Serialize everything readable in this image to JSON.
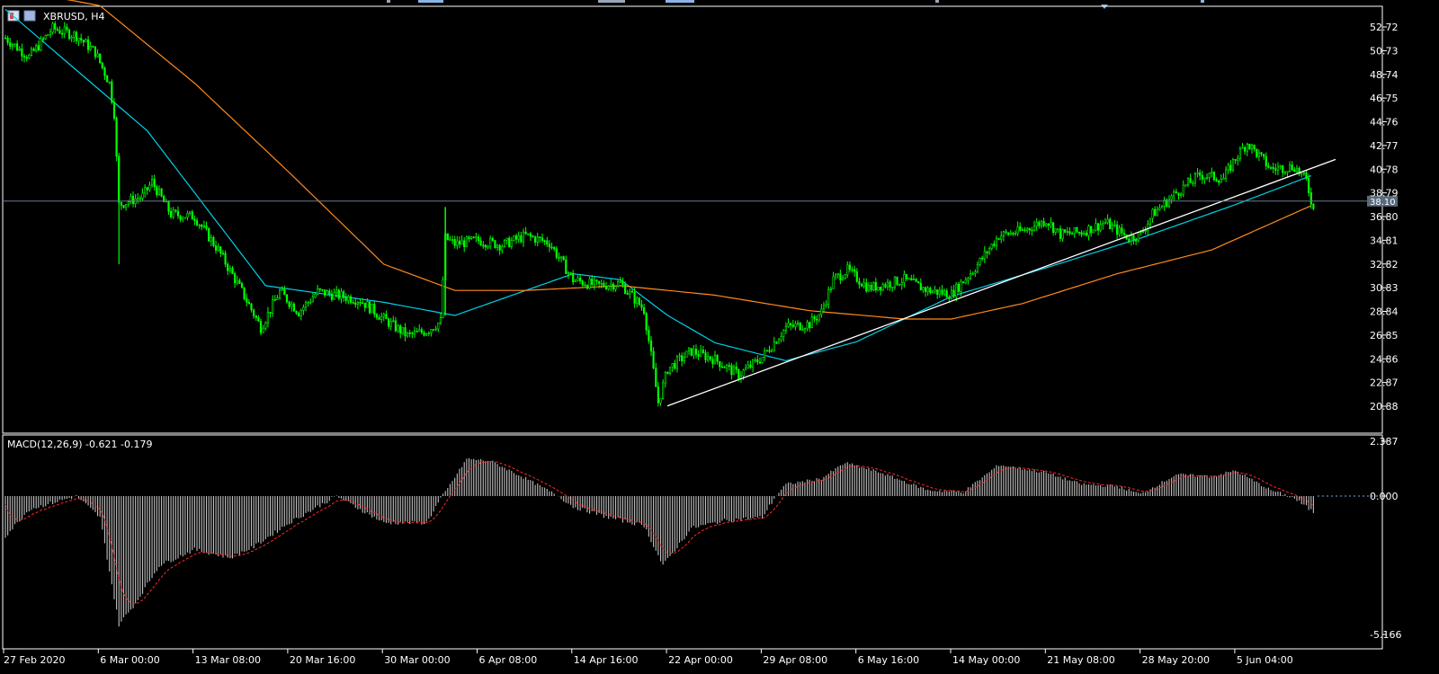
{
  "window": {
    "symbol_label": "XBRUSD, H4",
    "icon_name": "chart-window-icon"
  },
  "colors": {
    "background": "#000000",
    "bull_candle": "#00ff00",
    "bear_candle": "#00ff00",
    "ma_fast": "#00cfe8",
    "ma_slow": "#ff8a1c",
    "trendline": "#ffffff",
    "bid_line": "#6b7a8c",
    "price_tag_bg": "#5a6a7c",
    "macd_hist": "#c0c0c0",
    "macd_signal": "#ff2a2a",
    "axis_text": "#ffffff",
    "grid_frame": "#ffffff"
  },
  "price_axis": {
    "ticks": [
      "52.72",
      "50.73",
      "48.74",
      "46.75",
      "44.76",
      "42.77",
      "40.78",
      "38.79",
      "36.80",
      "34.81",
      "32.82",
      "30.83",
      "28.84",
      "26.85",
      "24.86",
      "22.87",
      "20.88"
    ],
    "current_price": "38.10"
  },
  "macd": {
    "label": "MACD(12,26,9) -0.621 -0.179",
    "ticks": [
      "2.387",
      "0.000",
      "-5.166"
    ]
  },
  "time_axis": {
    "ticks": [
      "27 Feb 2020",
      "6 Mar 00:00",
      "13 Mar 08:00",
      "20 Mar 16:00",
      "30 Mar 00:00",
      "6 Apr 08:00",
      "14 Apr 16:00",
      "22 Apr 00:00",
      "29 Apr 08:00",
      "6 May 16:00",
      "14 May 00:00",
      "21 May 08:00",
      "28 May 20:00",
      "5 Jun 04:00"
    ]
  },
  "chart_data": {
    "type": "candlestick",
    "symbol": "XBRUSD",
    "timeframe": "H4",
    "ylim": [
      19.9,
      53.7
    ],
    "current_price": 38.1,
    "anchors": [
      [
        0,
        51.8
      ],
      [
        10,
        50.2
      ],
      [
        20,
        52.6
      ],
      [
        30,
        52.0
      ],
      [
        38,
        50.6
      ],
      [
        44,
        48.0
      ],
      [
        46,
        45.5
      ],
      [
        48,
        37.8
      ],
      [
        58,
        38.5
      ],
      [
        62,
        39.7
      ],
      [
        70,
        37.0
      ],
      [
        80,
        36.8
      ],
      [
        90,
        34.0
      ],
      [
        100,
        30.5
      ],
      [
        108,
        27.5
      ],
      [
        116,
        30.5
      ],
      [
        124,
        28.8
      ],
      [
        132,
        30.5
      ],
      [
        140,
        30.2
      ],
      [
        150,
        29.8
      ],
      [
        160,
        28.2
      ],
      [
        170,
        26.8
      ],
      [
        178,
        27.2
      ],
      [
        184,
        28.0
      ],
      [
        186,
        35.0
      ],
      [
        190,
        34.5
      ],
      [
        200,
        34.8
      ],
      [
        210,
        34.4
      ],
      [
        220,
        35.2
      ],
      [
        230,
        34.6
      ],
      [
        240,
        31.5
      ],
      [
        250,
        31.0
      ],
      [
        260,
        31.2
      ],
      [
        270,
        29.0
      ],
      [
        276,
        21.2
      ],
      [
        280,
        24.0
      ],
      [
        290,
        25.5
      ],
      [
        300,
        24.8
      ],
      [
        310,
        23.5
      ],
      [
        320,
        25.0
      ],
      [
        330,
        27.5
      ],
      [
        340,
        27.8
      ],
      [
        345,
        28.8
      ],
      [
        350,
        31.5
      ],
      [
        356,
        32.3
      ],
      [
        365,
        30.8
      ],
      [
        380,
        31.5
      ],
      [
        390,
        30.6
      ],
      [
        400,
        30.3
      ],
      [
        410,
        32.5
      ],
      [
        420,
        35.2
      ],
      [
        430,
        35.6
      ],
      [
        440,
        36.5
      ],
      [
        446,
        35.3
      ],
      [
        455,
        35.5
      ],
      [
        465,
        36.3
      ],
      [
        475,
        35.0
      ],
      [
        480,
        35.3
      ],
      [
        485,
        37.0
      ],
      [
        495,
        38.8
      ],
      [
        505,
        40.3
      ],
      [
        515,
        40.0
      ],
      [
        520,
        41.7
      ],
      [
        525,
        43.0
      ],
      [
        535,
        40.8
      ],
      [
        545,
        41.0
      ],
      [
        550,
        39.8
      ],
      [
        553,
        37.4
      ]
    ],
    "moving_averages": [
      {
        "color": "cyan",
        "points": [
          [
            0,
            54.2
          ],
          [
            60,
            44.0
          ],
          [
            110,
            31.0
          ],
          [
            160,
            29.6
          ],
          [
            190,
            28.5
          ],
          [
            240,
            32.0
          ],
          [
            260,
            31.5
          ],
          [
            280,
            28.5
          ],
          [
            300,
            26.2
          ],
          [
            330,
            24.7
          ],
          [
            360,
            26.3
          ],
          [
            400,
            30.1
          ],
          [
            440,
            32.5
          ],
          [
            480,
            35.0
          ],
          [
            520,
            37.8
          ],
          [
            553,
            40.3
          ]
        ]
      },
      {
        "color": "orange",
        "points": [
          [
            0,
            56.0
          ],
          [
            40,
            54.5
          ],
          [
            80,
            48.0
          ],
          [
            120,
            40.5
          ],
          [
            160,
            32.8
          ],
          [
            190,
            30.6
          ],
          [
            220,
            30.6
          ],
          [
            260,
            31.0
          ],
          [
            300,
            30.2
          ],
          [
            340,
            28.9
          ],
          [
            380,
            28.2
          ],
          [
            400,
            28.2
          ],
          [
            430,
            29.5
          ],
          [
            470,
            32.0
          ],
          [
            510,
            34.0
          ],
          [
            553,
            37.8
          ]
        ]
      }
    ],
    "trendline": {
      "from": [
        "22 Apr 00:00",
        20.9
      ],
      "to": [
        560,
        41.1
      ]
    },
    "macd_indicator": {
      "params": "12,26,9",
      "main": -0.621,
      "signal": -0.179,
      "ylim": [
        -5.166,
        2.387
      ],
      "hist_anchors": [
        [
          0,
          -1.5
        ],
        [
          10,
          -0.5
        ],
        [
          30,
          0.0
        ],
        [
          40,
          -0.8
        ],
        [
          48,
          -4.8
        ],
        [
          55,
          -4.0
        ],
        [
          65,
          -2.6
        ],
        [
          80,
          -2.0
        ],
        [
          95,
          -2.3
        ],
        [
          105,
          -1.9
        ],
        [
          120,
          -1.0
        ],
        [
          140,
          0.0
        ],
        [
          160,
          -1.0
        ],
        [
          178,
          -1.0
        ],
        [
          186,
          0.2
        ],
        [
          195,
          1.9
        ],
        [
          205,
          1.8
        ],
        [
          220,
          0.9
        ],
        [
          240,
          -0.4
        ],
        [
          255,
          -0.8
        ],
        [
          270,
          -1.1
        ],
        [
          278,
          -2.6
        ],
        [
          290,
          -1.2
        ],
        [
          305,
          -0.9
        ],
        [
          320,
          -0.8
        ],
        [
          330,
          0.6
        ],
        [
          345,
          0.9
        ],
        [
          355,
          1.7
        ],
        [
          370,
          1.2
        ],
        [
          390,
          0.3
        ],
        [
          405,
          0.2
        ],
        [
          420,
          1.6
        ],
        [
          440,
          1.2
        ],
        [
          455,
          0.6
        ],
        [
          470,
          0.5
        ],
        [
          480,
          0.1
        ],
        [
          495,
          1.1
        ],
        [
          510,
          1.0
        ],
        [
          520,
          1.3
        ],
        [
          535,
          0.3
        ],
        [
          545,
          -0.1
        ],
        [
          553,
          -0.6
        ]
      ]
    }
  }
}
